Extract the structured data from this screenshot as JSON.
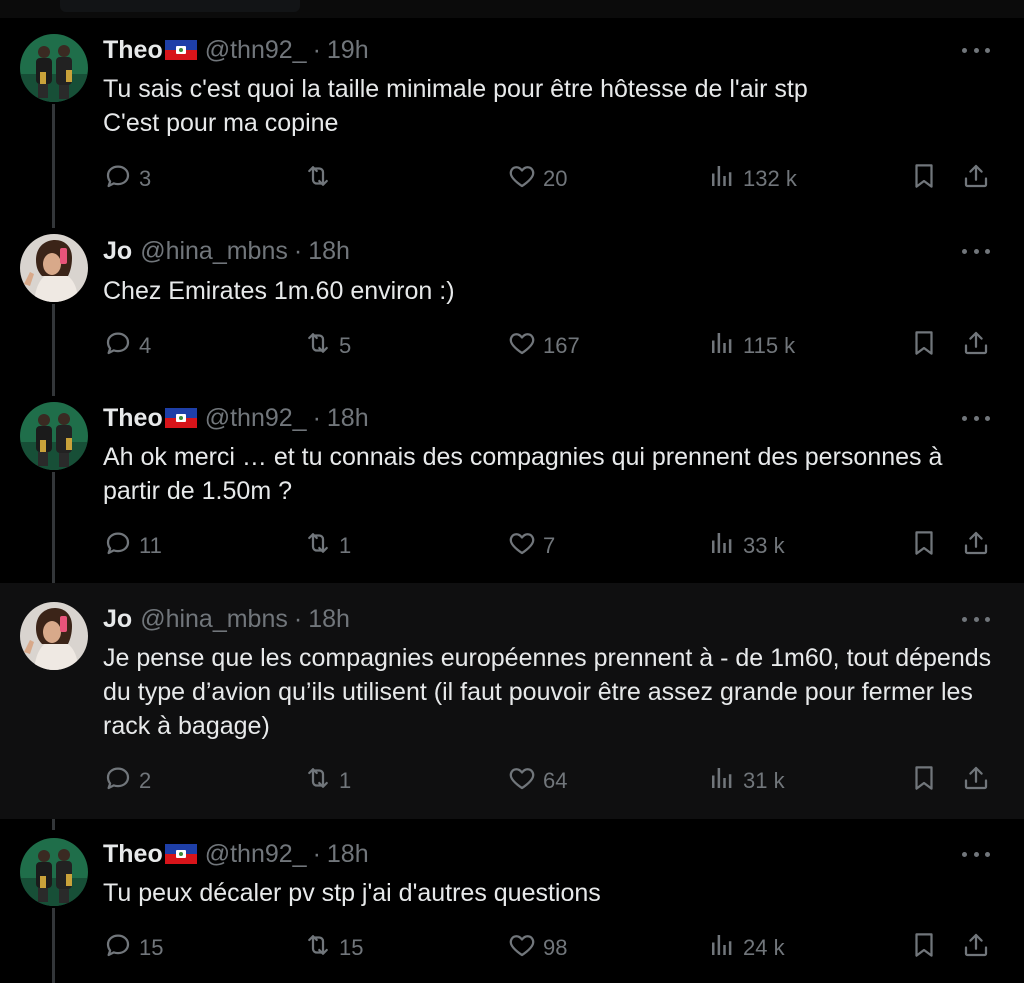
{
  "tweets": [
    {
      "name": "Theo",
      "flag": "haiti-flag",
      "handle": "@thn92_",
      "time": "19h",
      "text": "Tu sais c'est quoi la taille minimale pour être hôtesse de l'air stp\nC'est pour ma copine",
      "replies": "3",
      "retweets": "",
      "likes": "20",
      "views": "132 k"
    },
    {
      "name": "Jo",
      "flag": "",
      "handle": "@hina_mbns",
      "time": "18h",
      "text": "Chez Emirates 1m.60 environ :)",
      "replies": "4",
      "retweets": "5",
      "likes": "167",
      "views": "115 k"
    },
    {
      "name": "Theo",
      "flag": "haiti-flag",
      "handle": "@thn92_",
      "time": "18h",
      "text": "Ah ok merci … et tu connais des compagnies qui prennent des personnes à partir de 1.50m ?",
      "replies": "11",
      "retweets": "1",
      "likes": "7",
      "views": "33 k"
    },
    {
      "name": "Jo",
      "flag": "",
      "handle": "@hina_mbns",
      "time": "18h",
      "text": "Je pense que les compagnies européennes prennent à - de 1m60, tout dépends du type d’avion qu’ils utilisent (il faut pouvoir être assez grande pour fermer les rack à bagage)",
      "replies": "2",
      "retweets": "1",
      "likes": "64",
      "views": "31 k"
    },
    {
      "name": "Theo",
      "flag": "haiti-flag",
      "handle": "@thn92_",
      "time": "18h",
      "text": "Tu peux décaler pv stp j'ai d'autres questions",
      "replies": "15",
      "retweets": "15",
      "likes": "98",
      "views": "24 k"
    }
  ],
  "separator": "·",
  "colors": {
    "background": "#000000",
    "highlight": "#0f0f10",
    "text": "#e7e9ea",
    "muted": "#71767b",
    "thread_line": "#333639"
  },
  "icons": [
    "reply-icon",
    "retweet-icon",
    "like-icon",
    "views-icon",
    "bookmark-icon",
    "share-icon",
    "more-icon"
  ]
}
